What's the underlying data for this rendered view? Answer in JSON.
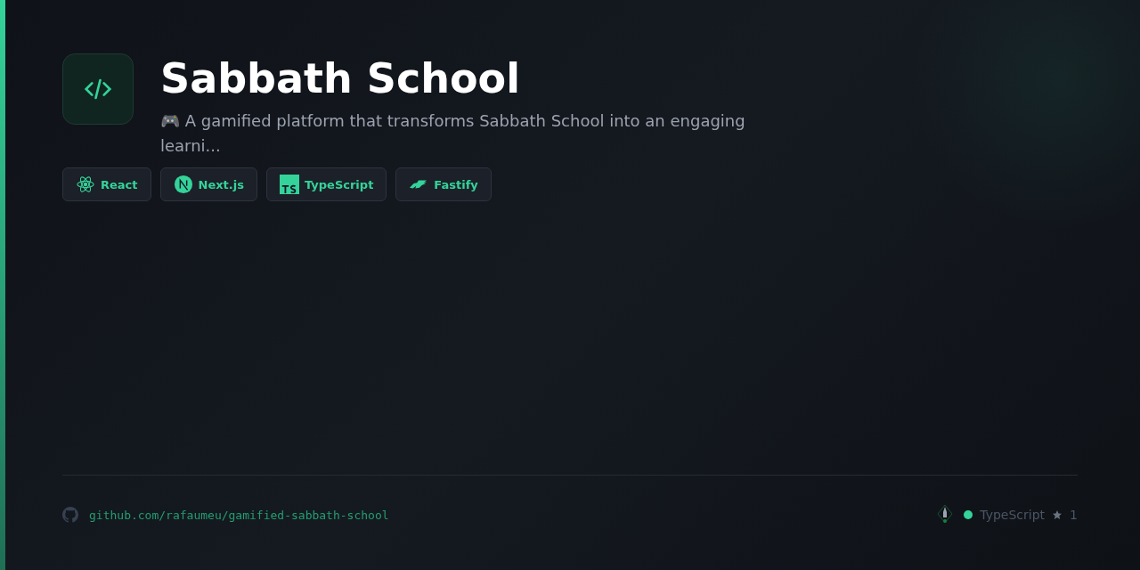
{
  "title": "Sabbath School",
  "description": "🎮 A gamified platform that transforms Sabbath School into an engaging learni...",
  "tech": [
    {
      "label": "React",
      "kind": "react"
    },
    {
      "label": "Next.js",
      "kind": "next"
    },
    {
      "label": "TypeScript",
      "kind": "ts"
    },
    {
      "label": "Fastify",
      "kind": "fastify"
    }
  ],
  "footer": {
    "repo": "github.com/rafaumeu/gamified-sabbath-school",
    "language": {
      "label": "TypeScript",
      "color": "#34d399"
    },
    "stars": "1"
  }
}
